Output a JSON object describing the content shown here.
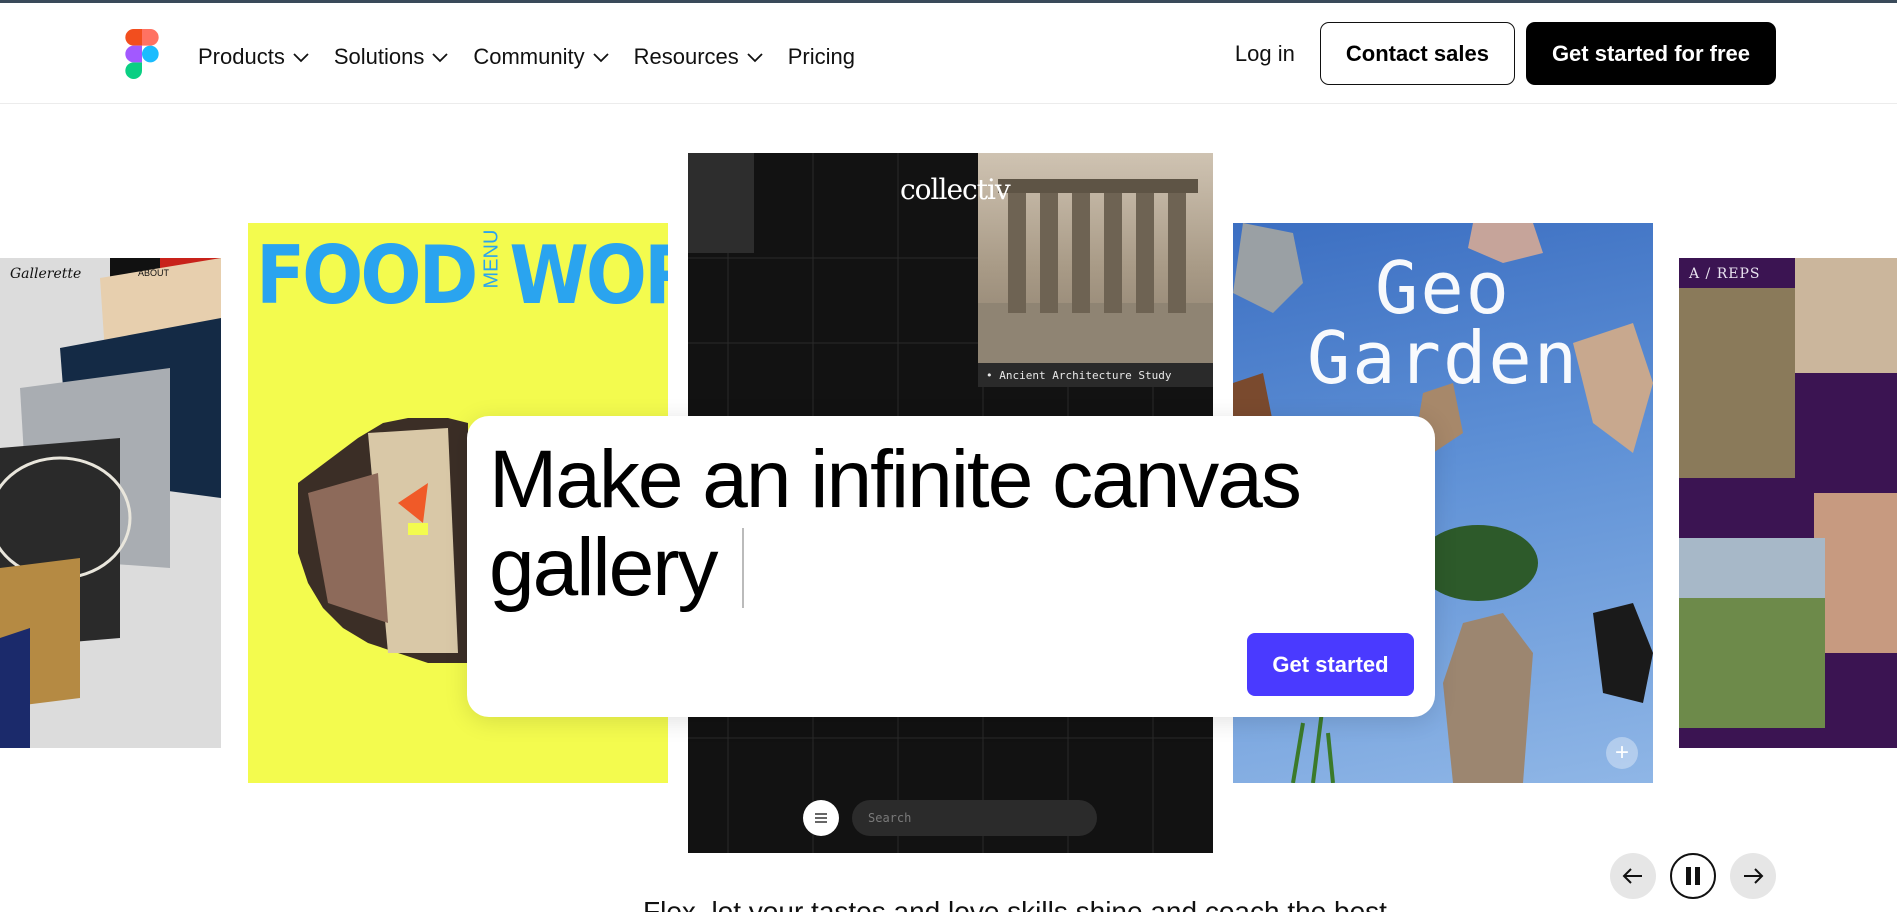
{
  "nav": {
    "items": [
      {
        "label": "Products",
        "dropdown": true
      },
      {
        "label": "Solutions",
        "dropdown": true
      },
      {
        "label": "Community",
        "dropdown": true
      },
      {
        "label": "Resources",
        "dropdown": true
      },
      {
        "label": "Pricing",
        "dropdown": false
      }
    ],
    "login_label": "Log in",
    "contact_label": "Contact sales",
    "cta_label": "Get started for free"
  },
  "gallery": {
    "left_card": {
      "title": "Gallerette",
      "about": "ABOUT"
    },
    "food_card": {
      "word1": "FOOD",
      "menu": "MENU",
      "word2": "WORKS"
    },
    "collectiv_card": {
      "logo": "collectiv",
      "caption": "Ancient Architecture Study",
      "search_placeholder": "Search"
    },
    "geo_card": {
      "line1": "Geo",
      "line2": "Garden"
    },
    "reps_card": {
      "title": "A / REPS"
    }
  },
  "hero": {
    "headline": "Make an infinite canvas gallery",
    "button_label": "Get started"
  },
  "colors": {
    "accent": "#4a3aff",
    "food_bg": "#f3fb4e",
    "food_text": "#2aa4ef",
    "reps_bg": "#3b1452"
  },
  "controls": {
    "prev_icon": "arrow-left-icon",
    "pause_icon": "pause-icon",
    "next_icon": "arrow-right-icon"
  },
  "subheading": "Flex, let your tastes and love skills shine and coach the best"
}
